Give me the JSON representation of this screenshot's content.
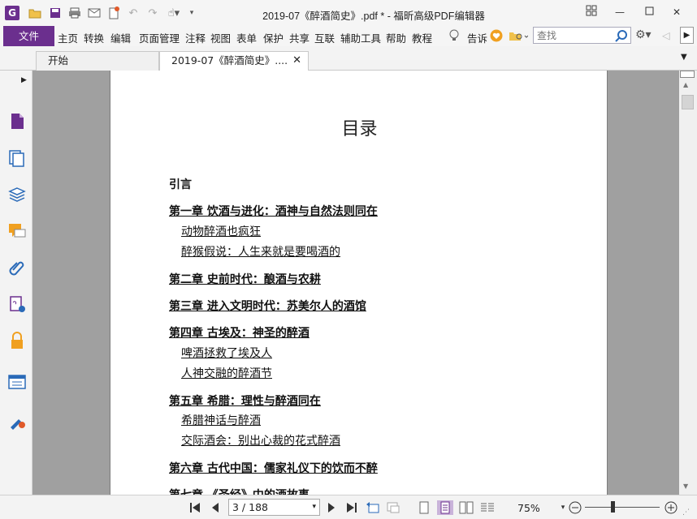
{
  "window": {
    "title": "2019-07《醉酒简史》.pdf * - 福昕高级PDF编辑器",
    "logo_letter": "G"
  },
  "menubar": {
    "file": "文件",
    "items": [
      "主页",
      "转换",
      "编辑",
      "页面管理",
      "注释",
      "视图",
      "表单",
      "保护",
      "共享",
      "互联",
      "辅助工具",
      "帮助",
      "教程"
    ],
    "tell_me": "告诉",
    "search_placeholder": "查找"
  },
  "tabs": [
    {
      "label": "开始",
      "active": false
    },
    {
      "label": "2019-07《醉酒简史》....",
      "active": true
    }
  ],
  "document": {
    "toc_title": "目录",
    "entries": [
      {
        "text": "引言",
        "level": "chap",
        "underline": false
      },
      {
        "text": "第一章 饮酒与进化：酒神与自然法则同在",
        "level": "chap"
      },
      {
        "text": "动物醉酒也疯狂",
        "level": "sect"
      },
      {
        "text": "醉猴假说：人生来就是要喝酒的",
        "level": "sect"
      },
      {
        "text": "第二章 史前时代：酿酒与农耕",
        "level": "chap"
      },
      {
        "text": "第三章 进入文明时代：苏美尔人的酒馆",
        "level": "chap"
      },
      {
        "text": "第四章 古埃及：神圣的醉酒",
        "level": "chap"
      },
      {
        "text": "啤酒拯救了埃及人",
        "level": "sect"
      },
      {
        "text": "人神交融的醉酒节",
        "level": "sect"
      },
      {
        "text": "第五章 希腊：理性与醉酒同在",
        "level": "chap"
      },
      {
        "text": "希腊神话与醉酒",
        "level": "sect"
      },
      {
        "text": "交际酒会：别出心裁的花式醉酒",
        "level": "sect"
      },
      {
        "text": "第六章 古代中国：儒家礼仪下的饮而不醉",
        "level": "chap"
      },
      {
        "text": "第七章 《圣经》中的酒故事",
        "level": "chap"
      }
    ]
  },
  "statusbar": {
    "page_indicator": "3 / 188",
    "zoom": "75%"
  },
  "colors": {
    "brand": "#6b2f8e",
    "doc_background": "#a0a0a0"
  }
}
